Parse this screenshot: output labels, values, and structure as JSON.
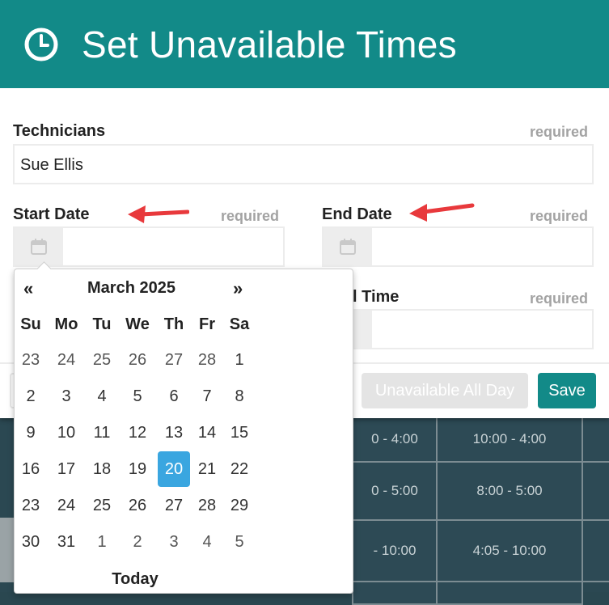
{
  "modal": {
    "title": "Set Unavailable Times",
    "technicians": {
      "label": "Technicians",
      "required": "required",
      "value": "Sue Ellis"
    },
    "start_date": {
      "label": "Start Date",
      "required": "required",
      "value": ""
    },
    "end_date": {
      "label": "End Date",
      "required": "required",
      "value": ""
    },
    "end_time": {
      "label_partial": "l Time",
      "required": "required",
      "value": ""
    },
    "buttons": {
      "all_day": "Unavailable All Day",
      "save": "Save"
    }
  },
  "datepicker": {
    "prev": "«",
    "next": "»",
    "month_label": "March 2025",
    "weekdays": [
      "Su",
      "Mo",
      "Tu",
      "We",
      "Th",
      "Fr",
      "Sa"
    ],
    "weeks": [
      [
        "23",
        "24",
        "25",
        "26",
        "27",
        "28",
        "1"
      ],
      [
        "2",
        "3",
        "4",
        "5",
        "6",
        "7",
        "8"
      ],
      [
        "9",
        "10",
        "11",
        "12",
        "13",
        "14",
        "15"
      ],
      [
        "16",
        "17",
        "18",
        "19",
        "20",
        "21",
        "22"
      ],
      [
        "23",
        "24",
        "25",
        "26",
        "27",
        "28",
        "29"
      ],
      [
        "30",
        "31",
        "1",
        "2",
        "3",
        "4",
        "5"
      ]
    ],
    "selected_day": "20",
    "today_label": "Today"
  },
  "schedule": {
    "rows": [
      [
        "0 - 4:00",
        "10:00 - 4:00"
      ],
      [
        "0 - 5:00",
        "8:00 - 5:00"
      ],
      [
        "- 10:00",
        "4:05 - 10:00"
      ]
    ]
  },
  "colors": {
    "header": "#128a88",
    "selected": "#3aa6e0",
    "arrow": "#e8393c"
  }
}
